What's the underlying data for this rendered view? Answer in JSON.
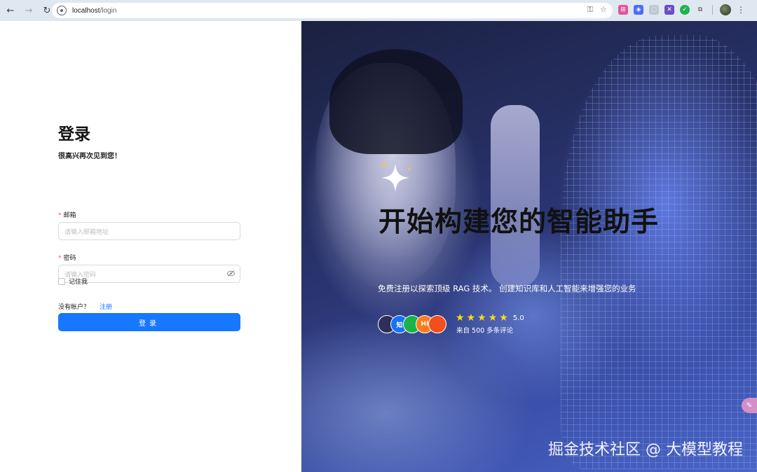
{
  "browser": {
    "url_host": "localhost",
    "url_path": "/login"
  },
  "login": {
    "title": "登录",
    "subtitle": "很高兴再次见到您！",
    "email_label": "邮箱",
    "email_placeholder": "请输入邮箱地址",
    "password_label": "密码",
    "password_placeholder": "请输入密码",
    "required_mark": "*",
    "remember_label": "记住我",
    "no_account_text": "没有帐户？",
    "register_link": "注册",
    "submit_label": "登录"
  },
  "hero": {
    "title": "开始构建您的智能助手",
    "subtitle": "免费注册以探索顶级 RAG 技术。 创建知识库和人工智能来增强您的业务",
    "avatars": [
      {
        "text": "",
        "color": "#2b2f5a"
      },
      {
        "text": "知",
        "color": "#1772f6"
      },
      {
        "text": "",
        "color": "#19b34a"
      },
      {
        "text": "HI",
        "color": "#ff7a1a"
      },
      {
        "text": "",
        "color": "#f24e1e"
      }
    ],
    "rating": "5.0",
    "reviews_text": "来自 500 多条评论"
  },
  "watermark": "掘金技术社区 @ 大模型教程"
}
